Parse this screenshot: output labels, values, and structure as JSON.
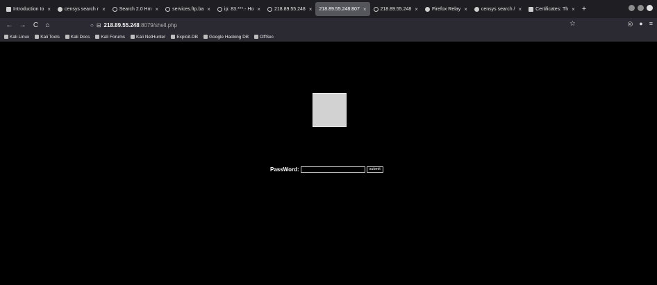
{
  "browser": {
    "tabs": [
      {
        "label": "Introduction to",
        "icon": "page-icon",
        "active": false
      },
      {
        "label": "censys search r",
        "icon": "globe-icon",
        "active": false
      },
      {
        "label": "Search 2.0 Hm",
        "icon": "info-icon",
        "active": false
      },
      {
        "label": "services.ftp.ba",
        "icon": "info-icon",
        "active": false
      },
      {
        "label": "ip: 83.***.- Ho",
        "icon": "info-icon",
        "active": false
      },
      {
        "label": "218.89.55.248",
        "icon": "info-icon",
        "active": false
      },
      {
        "label": "218.89.55.248:807",
        "icon": "",
        "active": true
      },
      {
        "label": "218.89.55.248",
        "icon": "info-icon",
        "active": false
      },
      {
        "label": "Firefox Relay",
        "icon": "relay-icon",
        "active": false
      },
      {
        "label": "censys search /",
        "icon": "globe-icon",
        "active": false
      },
      {
        "label": "Certificates: Th",
        "icon": "page-icon",
        "active": false
      }
    ],
    "tab_close_glyph": "×",
    "new_tab_glyph": "+",
    "nav": {
      "back": "←",
      "forward": "→",
      "reload": "C",
      "home": "⌂",
      "url_host": "218.89.55.248",
      "url_rest": ":8079/shell.php",
      "star": "☆",
      "right_icons": [
        "◎",
        "●",
        "≡"
      ]
    },
    "bookmarks": [
      "Kali Linux",
      "Kali Tools",
      "Kali Docs",
      "Kali Forums",
      "Kali NetHunter",
      "Exploit-DB",
      "Google Hacking DB",
      "OffSec"
    ]
  },
  "page": {
    "password_label": "PassWord:",
    "password_value": "",
    "submit_label": "submit"
  }
}
